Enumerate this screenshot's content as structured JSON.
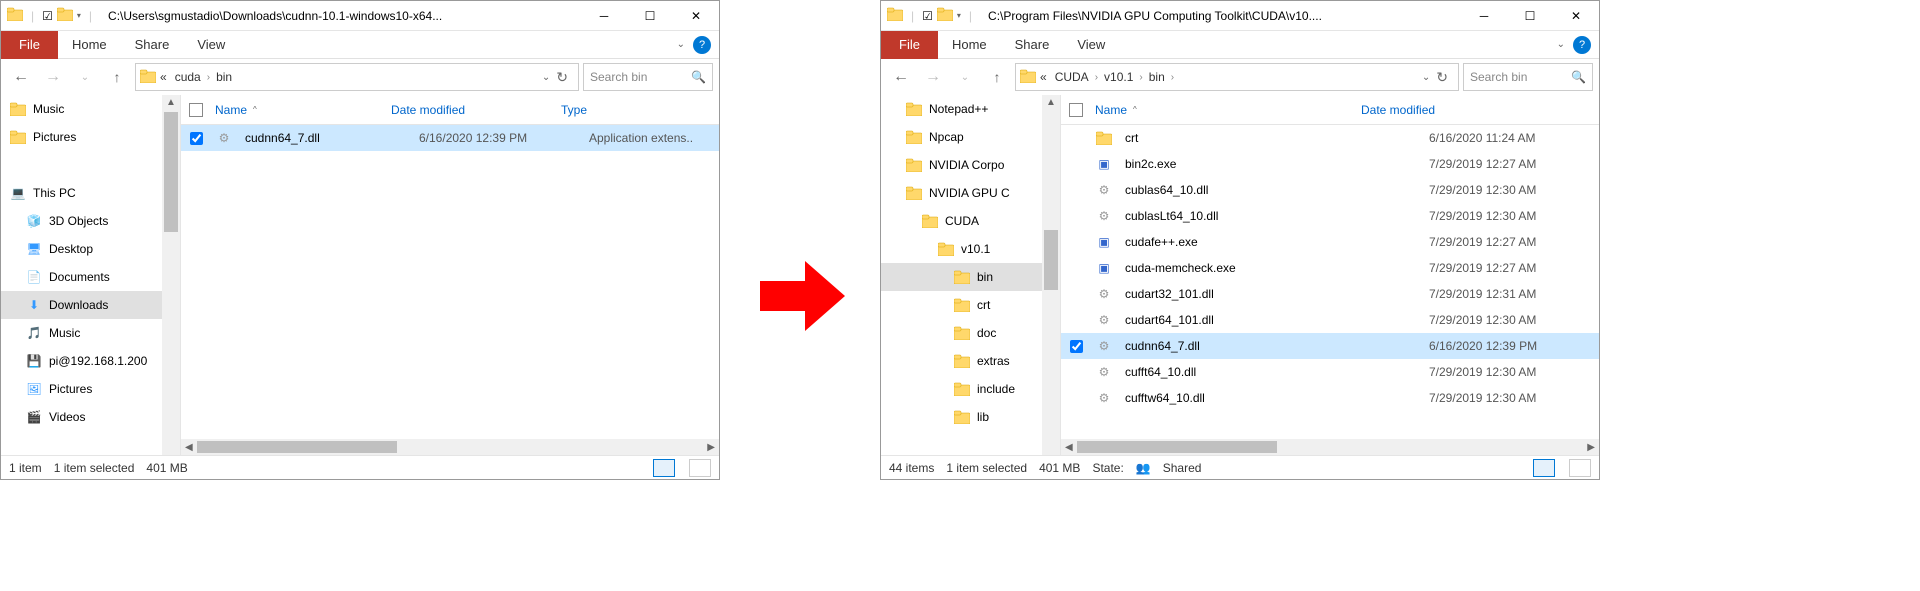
{
  "left": {
    "title": "C:\\Users\\sgmustadio\\Downloads\\cudnn-10.1-windows10-x64...",
    "tabs": {
      "file": "File",
      "home": "Home",
      "share": "Share",
      "view": "View"
    },
    "breadcrumb": [
      "«",
      "cuda",
      "bin"
    ],
    "search_placeholder": "Search bin",
    "tree": [
      {
        "label": "Music",
        "icon": "folder",
        "indent": 0
      },
      {
        "label": "Pictures",
        "icon": "folder",
        "indent": 0
      },
      {
        "label": "",
        "icon": "none",
        "indent": 0
      },
      {
        "label": "This PC",
        "icon": "pc",
        "indent": 0
      },
      {
        "label": "3D Objects",
        "icon": "3d",
        "indent": 1
      },
      {
        "label": "Desktop",
        "icon": "desktop",
        "indent": 1
      },
      {
        "label": "Documents",
        "icon": "docs",
        "indent": 1
      },
      {
        "label": "Downloads",
        "icon": "downloads",
        "indent": 1,
        "selected": true
      },
      {
        "label": "Music",
        "icon": "music",
        "indent": 1
      },
      {
        "label": "pi@192.168.1.200",
        "icon": "drive",
        "indent": 1
      },
      {
        "label": "Pictures",
        "icon": "pics",
        "indent": 1
      },
      {
        "label": "Videos",
        "icon": "videos",
        "indent": 1
      }
    ],
    "columns": {
      "name": "Name",
      "date": "Date modified",
      "type": "Type",
      "name_width": 180
    },
    "files": [
      {
        "name": "cudnn64_7.dll",
        "date": "6/16/2020 12:39 PM",
        "type": "Application extens..",
        "selected": true,
        "checked": true,
        "icon": "dll"
      }
    ],
    "status": {
      "count": "1 item",
      "selected": "1 item selected",
      "size": "401 MB"
    }
  },
  "right": {
    "title": "C:\\Program Files\\NVIDIA GPU Computing Toolkit\\CUDA\\v10....",
    "tabs": {
      "file": "File",
      "home": "Home",
      "share": "Share",
      "view": "View"
    },
    "breadcrumb": [
      "«",
      "CUDA",
      "v10.1",
      "bin"
    ],
    "search_placeholder": "Search bin",
    "tree": [
      {
        "label": "Notepad++",
        "icon": "folder",
        "indent": 1
      },
      {
        "label": "Npcap",
        "icon": "folder",
        "indent": 1
      },
      {
        "label": "NVIDIA Corpo",
        "icon": "folder",
        "indent": 1
      },
      {
        "label": "NVIDIA GPU C",
        "icon": "folder",
        "indent": 1
      },
      {
        "label": "CUDA",
        "icon": "folder",
        "indent": 2
      },
      {
        "label": "v10.1",
        "icon": "folder",
        "indent": 3
      },
      {
        "label": "bin",
        "icon": "folder",
        "indent": 4,
        "selected": true
      },
      {
        "label": "crt",
        "icon": "folder",
        "indent": 4
      },
      {
        "label": "doc",
        "icon": "folder",
        "indent": 4
      },
      {
        "label": "extras",
        "icon": "folder",
        "indent": 4
      },
      {
        "label": "include",
        "icon": "folder",
        "indent": 4
      },
      {
        "label": "lib",
        "icon": "folder",
        "indent": 4
      }
    ],
    "columns": {
      "name": "Name",
      "date": "Date modified",
      "name_width": 270
    },
    "files": [
      {
        "name": "crt",
        "date": "6/16/2020 11:24 AM",
        "icon": "folder"
      },
      {
        "name": "bin2c.exe",
        "date": "7/29/2019 12:27 AM",
        "icon": "exe"
      },
      {
        "name": "cublas64_10.dll",
        "date": "7/29/2019 12:30 AM",
        "icon": "dll"
      },
      {
        "name": "cublasLt64_10.dll",
        "date": "7/29/2019 12:30 AM",
        "icon": "dll"
      },
      {
        "name": "cudafe++.exe",
        "date": "7/29/2019 12:27 AM",
        "icon": "exe"
      },
      {
        "name": "cuda-memcheck.exe",
        "date": "7/29/2019 12:27 AM",
        "icon": "exe"
      },
      {
        "name": "cudart32_101.dll",
        "date": "7/29/2019 12:31 AM",
        "icon": "dll"
      },
      {
        "name": "cudart64_101.dll",
        "date": "7/29/2019 12:30 AM",
        "icon": "dll"
      },
      {
        "name": "cudnn64_7.dll",
        "date": "6/16/2020 12:39 PM",
        "icon": "dll",
        "selected": true,
        "checked": true
      },
      {
        "name": "cufft64_10.dll",
        "date": "7/29/2019 12:30 AM",
        "icon": "dll"
      },
      {
        "name": "cufftw64_10.dll",
        "date": "7/29/2019 12:30 AM",
        "icon": "dll"
      }
    ],
    "status": {
      "count": "44 items",
      "selected": "1 item selected",
      "size": "401 MB",
      "state": "State:",
      "shared": "Shared"
    }
  }
}
